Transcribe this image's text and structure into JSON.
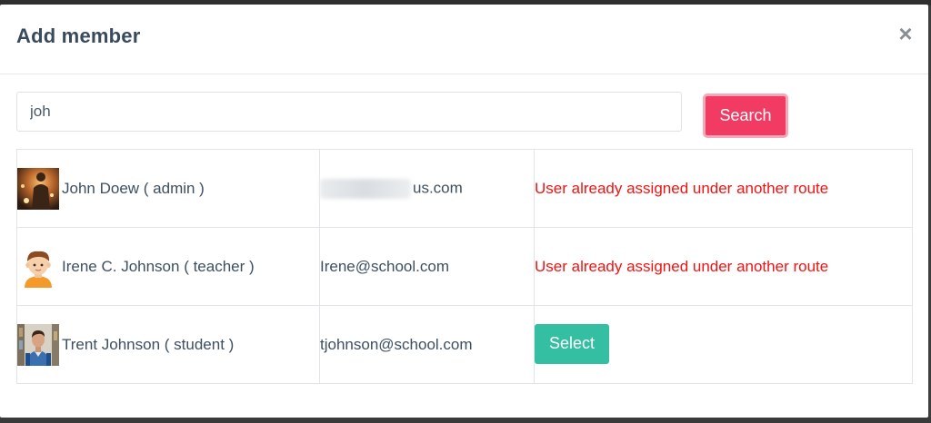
{
  "modal": {
    "title": "Add member",
    "close_label": "×"
  },
  "search": {
    "value": "joh",
    "placeholder": "",
    "button_label": "Search"
  },
  "results": [
    {
      "name": "John Doew ( admin )",
      "email_visible": "us.com",
      "email_redacted": true,
      "status": "User already assigned under another route",
      "avatar_icon": "photo-avatar-icon"
    },
    {
      "name": "Irene C. Johnson ( teacher )",
      "email_visible": "Irene@school.com",
      "email_redacted": false,
      "status": "User already assigned under another route",
      "avatar_icon": "cartoon-boy-avatar-icon"
    },
    {
      "name": "Trent Johnson ( student )",
      "email_visible": "tjohnson@school.com",
      "email_redacted": false,
      "action_label": "Select",
      "avatar_icon": "student-photo-avatar-icon"
    }
  ],
  "colors": {
    "title": "#384a5c",
    "search_button": "#f23b62",
    "select_button": "#35bfa2",
    "error_text": "#f21313"
  }
}
